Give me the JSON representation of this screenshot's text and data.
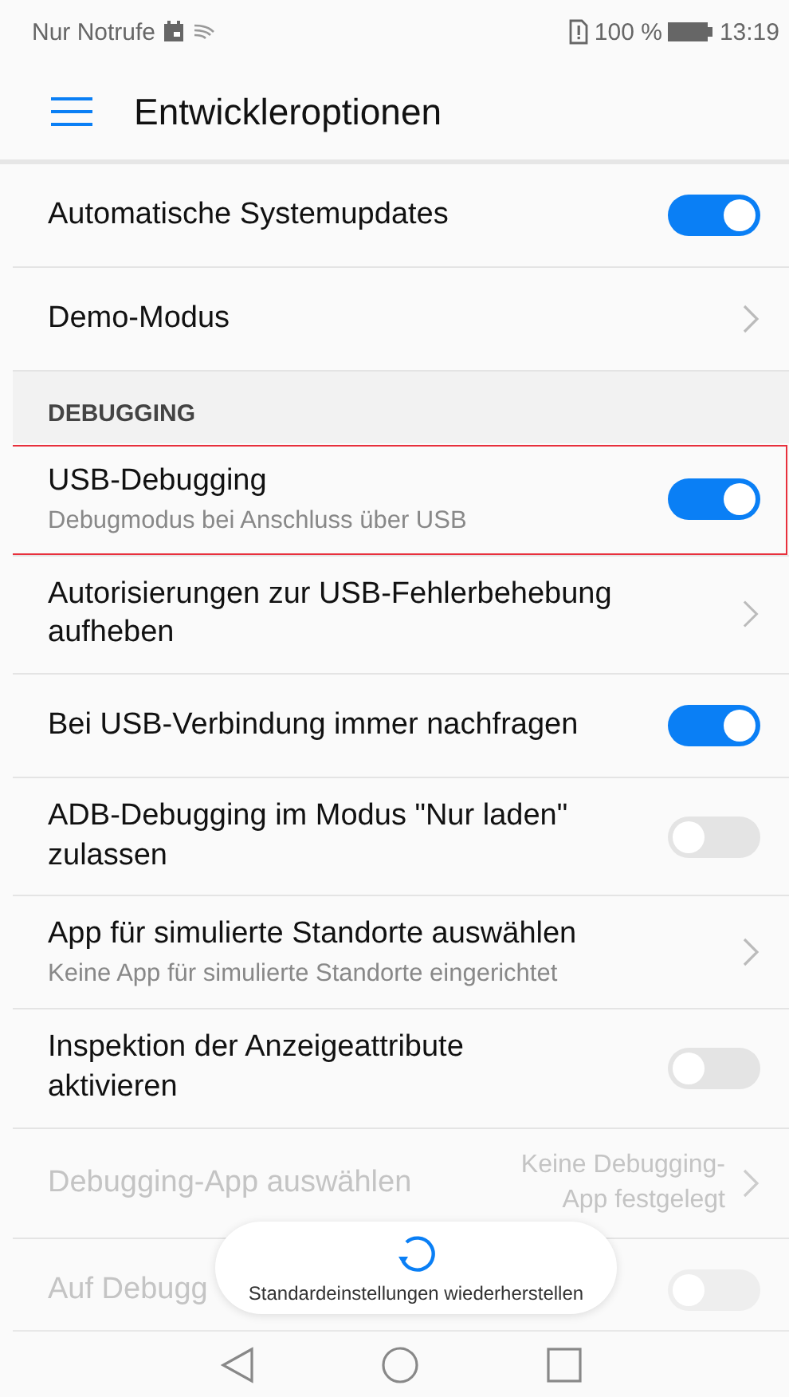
{
  "status_bar": {
    "carrier": "Nur Notrufe",
    "battery": "100 %",
    "time": "13:19"
  },
  "app_bar": {
    "title": "Entwickleroptionen"
  },
  "sections": [
    {
      "items": [
        {
          "kind": "toggle",
          "title": "Automatische Systemupdates",
          "on": true,
          "disabled": false,
          "highlighted": false
        },
        {
          "kind": "link",
          "title": "Demo-Modus",
          "disabled": false,
          "highlighted": false
        }
      ]
    },
    {
      "header": "DEBUGGING",
      "items": [
        {
          "kind": "toggle",
          "title": "USB-Debugging",
          "subtitle": "Debugmodus bei Anschluss über USB",
          "on": true,
          "disabled": false,
          "highlighted": true
        },
        {
          "kind": "link",
          "title": "Autorisierungen zur USB-Fehlerbehebung aufheben",
          "disabled": false,
          "highlighted": false
        },
        {
          "kind": "toggle",
          "title": "Bei USB-Verbindung immer nachfragen",
          "on": true,
          "disabled": false,
          "highlighted": false
        },
        {
          "kind": "toggle",
          "title": "ADB-Debugging im Modus \"Nur laden\" zulassen",
          "on": false,
          "disabled": false,
          "highlighted": false
        },
        {
          "kind": "link",
          "title": "App für simulierte Standorte auswählen",
          "subtitle": "Keine App für simulierte Standorte eingerichtet",
          "disabled": false,
          "highlighted": false
        },
        {
          "kind": "toggle",
          "title": "Inspektion der Anzeigeattribute aktivieren",
          "on": false,
          "disabled": false,
          "highlighted": false
        },
        {
          "kind": "link",
          "title": "Debugging-App auswählen",
          "value": "Keine Debugging-App festgelegt",
          "disabled": true,
          "highlighted": false
        },
        {
          "kind": "toggle",
          "title": "Auf Debugg",
          "on": false,
          "disabled": true,
          "highlighted": false
        }
      ]
    }
  ],
  "toast": {
    "text": "Standardeinstellungen wiederherstellen"
  }
}
